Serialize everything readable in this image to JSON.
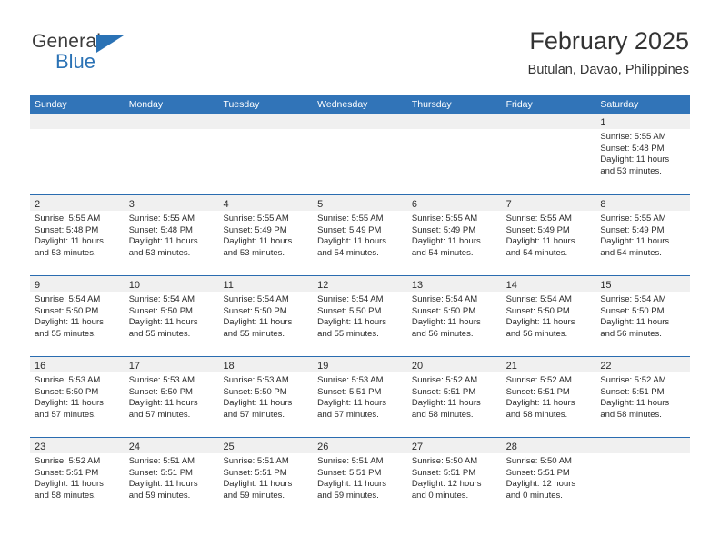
{
  "brand": {
    "name_top": "General",
    "name_bottom": "Blue",
    "triangle_icon": "triangle-icon",
    "colors": {
      "blue": "#2a72b5",
      "dark": "#3b3b3b"
    }
  },
  "header": {
    "title": "February 2025",
    "subtitle": "Butulan, Davao, Philippines"
  },
  "colors": {
    "header_blue": "#3174b8",
    "row_divider_blue": "#2a6cb0",
    "day_band_gray": "#f0f0f0",
    "text": "#2b2b2b"
  },
  "calendar": {
    "weekdays": [
      "Sunday",
      "Monday",
      "Tuesday",
      "Wednesday",
      "Thursday",
      "Friday",
      "Saturday"
    ],
    "weeks": [
      [
        {
          "day": "",
          "empty": true
        },
        {
          "day": "",
          "empty": true
        },
        {
          "day": "",
          "empty": true
        },
        {
          "day": "",
          "empty": true
        },
        {
          "day": "",
          "empty": true
        },
        {
          "day": "",
          "empty": true
        },
        {
          "day": "1",
          "sunrise": "Sunrise: 5:55 AM",
          "sunset": "Sunset: 5:48 PM",
          "daylight": "Daylight: 11 hours and 53 minutes."
        }
      ],
      [
        {
          "day": "2",
          "sunrise": "Sunrise: 5:55 AM",
          "sunset": "Sunset: 5:48 PM",
          "daylight": "Daylight: 11 hours and 53 minutes."
        },
        {
          "day": "3",
          "sunrise": "Sunrise: 5:55 AM",
          "sunset": "Sunset: 5:48 PM",
          "daylight": "Daylight: 11 hours and 53 minutes."
        },
        {
          "day": "4",
          "sunrise": "Sunrise: 5:55 AM",
          "sunset": "Sunset: 5:49 PM",
          "daylight": "Daylight: 11 hours and 53 minutes."
        },
        {
          "day": "5",
          "sunrise": "Sunrise: 5:55 AM",
          "sunset": "Sunset: 5:49 PM",
          "daylight": "Daylight: 11 hours and 54 minutes."
        },
        {
          "day": "6",
          "sunrise": "Sunrise: 5:55 AM",
          "sunset": "Sunset: 5:49 PM",
          "daylight": "Daylight: 11 hours and 54 minutes."
        },
        {
          "day": "7",
          "sunrise": "Sunrise: 5:55 AM",
          "sunset": "Sunset: 5:49 PM",
          "daylight": "Daylight: 11 hours and 54 minutes."
        },
        {
          "day": "8",
          "sunrise": "Sunrise: 5:55 AM",
          "sunset": "Sunset: 5:49 PM",
          "daylight": "Daylight: 11 hours and 54 minutes."
        }
      ],
      [
        {
          "day": "9",
          "sunrise": "Sunrise: 5:54 AM",
          "sunset": "Sunset: 5:50 PM",
          "daylight": "Daylight: 11 hours and 55 minutes."
        },
        {
          "day": "10",
          "sunrise": "Sunrise: 5:54 AM",
          "sunset": "Sunset: 5:50 PM",
          "daylight": "Daylight: 11 hours and 55 minutes."
        },
        {
          "day": "11",
          "sunrise": "Sunrise: 5:54 AM",
          "sunset": "Sunset: 5:50 PM",
          "daylight": "Daylight: 11 hours and 55 minutes."
        },
        {
          "day": "12",
          "sunrise": "Sunrise: 5:54 AM",
          "sunset": "Sunset: 5:50 PM",
          "daylight": "Daylight: 11 hours and 55 minutes."
        },
        {
          "day": "13",
          "sunrise": "Sunrise: 5:54 AM",
          "sunset": "Sunset: 5:50 PM",
          "daylight": "Daylight: 11 hours and 56 minutes."
        },
        {
          "day": "14",
          "sunrise": "Sunrise: 5:54 AM",
          "sunset": "Sunset: 5:50 PM",
          "daylight": "Daylight: 11 hours and 56 minutes."
        },
        {
          "day": "15",
          "sunrise": "Sunrise: 5:54 AM",
          "sunset": "Sunset: 5:50 PM",
          "daylight": "Daylight: 11 hours and 56 minutes."
        }
      ],
      [
        {
          "day": "16",
          "sunrise": "Sunrise: 5:53 AM",
          "sunset": "Sunset: 5:50 PM",
          "daylight": "Daylight: 11 hours and 57 minutes."
        },
        {
          "day": "17",
          "sunrise": "Sunrise: 5:53 AM",
          "sunset": "Sunset: 5:50 PM",
          "daylight": "Daylight: 11 hours and 57 minutes."
        },
        {
          "day": "18",
          "sunrise": "Sunrise: 5:53 AM",
          "sunset": "Sunset: 5:50 PM",
          "daylight": "Daylight: 11 hours and 57 minutes."
        },
        {
          "day": "19",
          "sunrise": "Sunrise: 5:53 AM",
          "sunset": "Sunset: 5:51 PM",
          "daylight": "Daylight: 11 hours and 57 minutes."
        },
        {
          "day": "20",
          "sunrise": "Sunrise: 5:52 AM",
          "sunset": "Sunset: 5:51 PM",
          "daylight": "Daylight: 11 hours and 58 minutes."
        },
        {
          "day": "21",
          "sunrise": "Sunrise: 5:52 AM",
          "sunset": "Sunset: 5:51 PM",
          "daylight": "Daylight: 11 hours and 58 minutes."
        },
        {
          "day": "22",
          "sunrise": "Sunrise: 5:52 AM",
          "sunset": "Sunset: 5:51 PM",
          "daylight": "Daylight: 11 hours and 58 minutes."
        }
      ],
      [
        {
          "day": "23",
          "sunrise": "Sunrise: 5:52 AM",
          "sunset": "Sunset: 5:51 PM",
          "daylight": "Daylight: 11 hours and 58 minutes."
        },
        {
          "day": "24",
          "sunrise": "Sunrise: 5:51 AM",
          "sunset": "Sunset: 5:51 PM",
          "daylight": "Daylight: 11 hours and 59 minutes."
        },
        {
          "day": "25",
          "sunrise": "Sunrise: 5:51 AM",
          "sunset": "Sunset: 5:51 PM",
          "daylight": "Daylight: 11 hours and 59 minutes."
        },
        {
          "day": "26",
          "sunrise": "Sunrise: 5:51 AM",
          "sunset": "Sunset: 5:51 PM",
          "daylight": "Daylight: 11 hours and 59 minutes."
        },
        {
          "day": "27",
          "sunrise": "Sunrise: 5:50 AM",
          "sunset": "Sunset: 5:51 PM",
          "daylight": "Daylight: 12 hours and 0 minutes."
        },
        {
          "day": "28",
          "sunrise": "Sunrise: 5:50 AM",
          "sunset": "Sunset: 5:51 PM",
          "daylight": "Daylight: 12 hours and 0 minutes."
        },
        {
          "day": "",
          "empty": true
        }
      ]
    ]
  }
}
